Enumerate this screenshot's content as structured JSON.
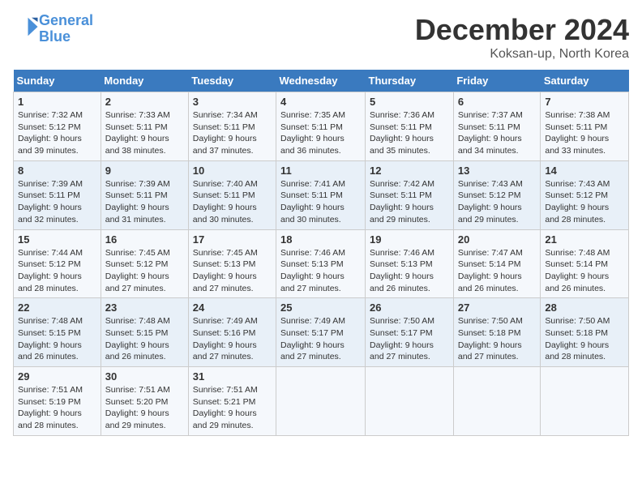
{
  "header": {
    "logo_line1": "General",
    "logo_line2": "Blue",
    "month": "December 2024",
    "location": "Koksan-up, North Korea"
  },
  "weekdays": [
    "Sunday",
    "Monday",
    "Tuesday",
    "Wednesday",
    "Thursday",
    "Friday",
    "Saturday"
  ],
  "weeks": [
    [
      {
        "day": "1",
        "sunrise": "Sunrise: 7:32 AM",
        "sunset": "Sunset: 5:12 PM",
        "daylight": "Daylight: 9 hours and 39 minutes."
      },
      {
        "day": "2",
        "sunrise": "Sunrise: 7:33 AM",
        "sunset": "Sunset: 5:11 PM",
        "daylight": "Daylight: 9 hours and 38 minutes."
      },
      {
        "day": "3",
        "sunrise": "Sunrise: 7:34 AM",
        "sunset": "Sunset: 5:11 PM",
        "daylight": "Daylight: 9 hours and 37 minutes."
      },
      {
        "day": "4",
        "sunrise": "Sunrise: 7:35 AM",
        "sunset": "Sunset: 5:11 PM",
        "daylight": "Daylight: 9 hours and 36 minutes."
      },
      {
        "day": "5",
        "sunrise": "Sunrise: 7:36 AM",
        "sunset": "Sunset: 5:11 PM",
        "daylight": "Daylight: 9 hours and 35 minutes."
      },
      {
        "day": "6",
        "sunrise": "Sunrise: 7:37 AM",
        "sunset": "Sunset: 5:11 PM",
        "daylight": "Daylight: 9 hours and 34 minutes."
      },
      {
        "day": "7",
        "sunrise": "Sunrise: 7:38 AM",
        "sunset": "Sunset: 5:11 PM",
        "daylight": "Daylight: 9 hours and 33 minutes."
      }
    ],
    [
      {
        "day": "8",
        "sunrise": "Sunrise: 7:39 AM",
        "sunset": "Sunset: 5:11 PM",
        "daylight": "Daylight: 9 hours and 32 minutes."
      },
      {
        "day": "9",
        "sunrise": "Sunrise: 7:39 AM",
        "sunset": "Sunset: 5:11 PM",
        "daylight": "Daylight: 9 hours and 31 minutes."
      },
      {
        "day": "10",
        "sunrise": "Sunrise: 7:40 AM",
        "sunset": "Sunset: 5:11 PM",
        "daylight": "Daylight: 9 hours and 30 minutes."
      },
      {
        "day": "11",
        "sunrise": "Sunrise: 7:41 AM",
        "sunset": "Sunset: 5:11 PM",
        "daylight": "Daylight: 9 hours and 30 minutes."
      },
      {
        "day": "12",
        "sunrise": "Sunrise: 7:42 AM",
        "sunset": "Sunset: 5:11 PM",
        "daylight": "Daylight: 9 hours and 29 minutes."
      },
      {
        "day": "13",
        "sunrise": "Sunrise: 7:43 AM",
        "sunset": "Sunset: 5:12 PM",
        "daylight": "Daylight: 9 hours and 29 minutes."
      },
      {
        "day": "14",
        "sunrise": "Sunrise: 7:43 AM",
        "sunset": "Sunset: 5:12 PM",
        "daylight": "Daylight: 9 hours and 28 minutes."
      }
    ],
    [
      {
        "day": "15",
        "sunrise": "Sunrise: 7:44 AM",
        "sunset": "Sunset: 5:12 PM",
        "daylight": "Daylight: 9 hours and 28 minutes."
      },
      {
        "day": "16",
        "sunrise": "Sunrise: 7:45 AM",
        "sunset": "Sunset: 5:12 PM",
        "daylight": "Daylight: 9 hours and 27 minutes."
      },
      {
        "day": "17",
        "sunrise": "Sunrise: 7:45 AM",
        "sunset": "Sunset: 5:13 PM",
        "daylight": "Daylight: 9 hours and 27 minutes."
      },
      {
        "day": "18",
        "sunrise": "Sunrise: 7:46 AM",
        "sunset": "Sunset: 5:13 PM",
        "daylight": "Daylight: 9 hours and 27 minutes."
      },
      {
        "day": "19",
        "sunrise": "Sunrise: 7:46 AM",
        "sunset": "Sunset: 5:13 PM",
        "daylight": "Daylight: 9 hours and 26 minutes."
      },
      {
        "day": "20",
        "sunrise": "Sunrise: 7:47 AM",
        "sunset": "Sunset: 5:14 PM",
        "daylight": "Daylight: 9 hours and 26 minutes."
      },
      {
        "day": "21",
        "sunrise": "Sunrise: 7:48 AM",
        "sunset": "Sunset: 5:14 PM",
        "daylight": "Daylight: 9 hours and 26 minutes."
      }
    ],
    [
      {
        "day": "22",
        "sunrise": "Sunrise: 7:48 AM",
        "sunset": "Sunset: 5:15 PM",
        "daylight": "Daylight: 9 hours and 26 minutes."
      },
      {
        "day": "23",
        "sunrise": "Sunrise: 7:48 AM",
        "sunset": "Sunset: 5:15 PM",
        "daylight": "Daylight: 9 hours and 26 minutes."
      },
      {
        "day": "24",
        "sunrise": "Sunrise: 7:49 AM",
        "sunset": "Sunset: 5:16 PM",
        "daylight": "Daylight: 9 hours and 27 minutes."
      },
      {
        "day": "25",
        "sunrise": "Sunrise: 7:49 AM",
        "sunset": "Sunset: 5:17 PM",
        "daylight": "Daylight: 9 hours and 27 minutes."
      },
      {
        "day": "26",
        "sunrise": "Sunrise: 7:50 AM",
        "sunset": "Sunset: 5:17 PM",
        "daylight": "Daylight: 9 hours and 27 minutes."
      },
      {
        "day": "27",
        "sunrise": "Sunrise: 7:50 AM",
        "sunset": "Sunset: 5:18 PM",
        "daylight": "Daylight: 9 hours and 27 minutes."
      },
      {
        "day": "28",
        "sunrise": "Sunrise: 7:50 AM",
        "sunset": "Sunset: 5:18 PM",
        "daylight": "Daylight: 9 hours and 28 minutes."
      }
    ],
    [
      {
        "day": "29",
        "sunrise": "Sunrise: 7:51 AM",
        "sunset": "Sunset: 5:19 PM",
        "daylight": "Daylight: 9 hours and 28 minutes."
      },
      {
        "day": "30",
        "sunrise": "Sunrise: 7:51 AM",
        "sunset": "Sunset: 5:20 PM",
        "daylight": "Daylight: 9 hours and 29 minutes."
      },
      {
        "day": "31",
        "sunrise": "Sunrise: 7:51 AM",
        "sunset": "Sunset: 5:21 PM",
        "daylight": "Daylight: 9 hours and 29 minutes."
      },
      null,
      null,
      null,
      null
    ]
  ]
}
